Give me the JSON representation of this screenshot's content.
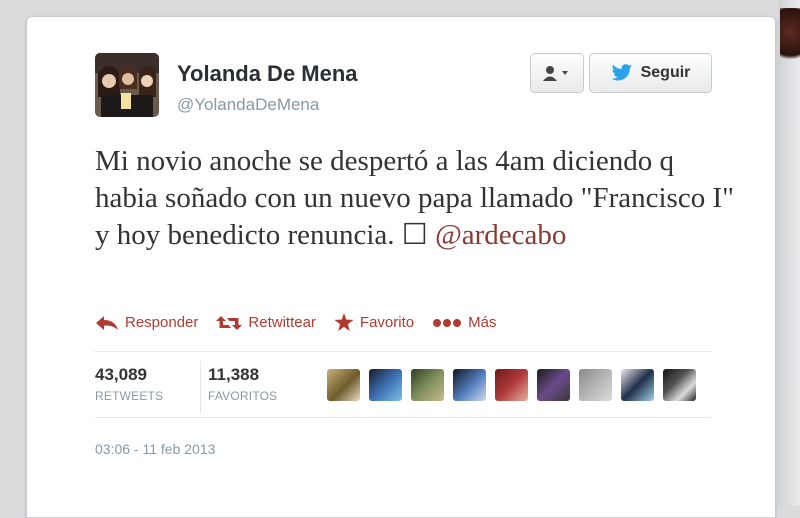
{
  "author": {
    "name": "Yolanda De Mena",
    "handle": "@YolandaDeMena"
  },
  "buttons": {
    "user_icon": "user-menu-icon",
    "follow_label": "Seguir"
  },
  "tweet": {
    "text": "Mi novio anoche se despertó a las 4am diciendo q habia soñado con un nuevo papa llamado \"Francisco I\" y hoy benedicto renuncia. ☐ ",
    "mention": "@ardecabo"
  },
  "actions": [
    {
      "label": "Responder",
      "icon": "reply-icon"
    },
    {
      "label": "Retwittear",
      "icon": "retweet-icon"
    },
    {
      "label": "Favorito",
      "icon": "star-icon"
    },
    {
      "label": "Más",
      "icon": "more-dots-icon"
    }
  ],
  "stats": {
    "retweets_count": "43,089",
    "retweets_label": "RETWEETS",
    "favorites_count": "11,388",
    "favorites_label": "FAVORITOS"
  },
  "favoriter_avatars_count": 9,
  "timestamp": "03:06 - 11 feb 2013",
  "colors": {
    "accent": "#b23b31",
    "mention": "#8a3a34",
    "muted": "#8899a6",
    "twitter_blue": "#1da1f2"
  }
}
